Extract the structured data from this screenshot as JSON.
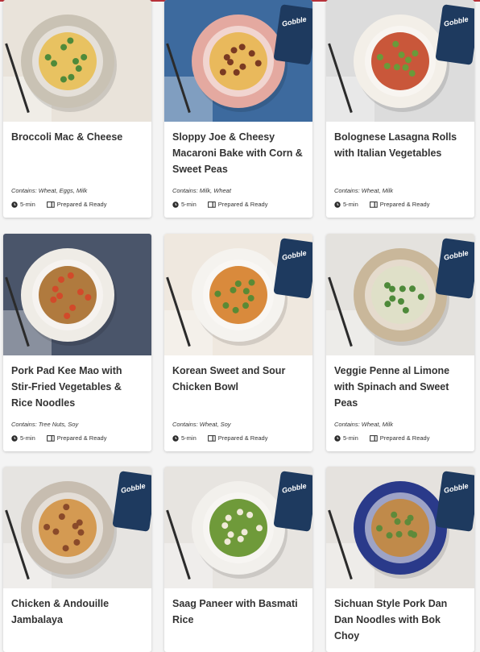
{
  "meals": [
    {
      "title": "Broccoli Mac & Cheese",
      "contains": "Contains: Wheat, Eggs, Milk",
      "time": "5-min",
      "tag": "Prepared & Ready",
      "plate_color": "#c9c2b4",
      "food_color": "#e8c261",
      "accent_color": "#4f8a3a",
      "bg_color": "#e9e3da"
    },
    {
      "title": "Sloppy Joe & Cheesy Macaroni Bake with Corn & Sweet Peas",
      "contains": "Contains: Milk, Wheat",
      "time": "5-min",
      "tag": "Prepared & Ready",
      "plate_color": "#e4a9a0",
      "food_color": "#e9b95c",
      "accent_color": "#7a3a22",
      "bg_color": "#3d6a9e"
    },
    {
      "title": "Bolognese Lasagna Rolls with Italian Vegetables",
      "contains": "Contains: Wheat, Milk",
      "time": "5-min",
      "tag": "Prepared & Ready",
      "plate_color": "#f3efe8",
      "food_color": "#c9573a",
      "accent_color": "#6a9a3a",
      "bg_color": "#dcdcdc"
    },
    {
      "title": "Pork Pad Kee Mao with Stir-Fried Vegetables & Rice Noodles",
      "contains": "Contains: Tree Nuts, Soy",
      "time": "5-min",
      "tag": "Prepared & Ready",
      "plate_color": "#efece6",
      "food_color": "#b07a3e",
      "accent_color": "#d24a2a",
      "bg_color": "#4a556a"
    },
    {
      "title": "Korean Sweet and Sour Chicken Bowl",
      "contains": "Contains: Wheat, Soy",
      "time": "5-min",
      "tag": "Prepared & Ready",
      "plate_color": "#f5f3ef",
      "food_color": "#d98a3c",
      "accent_color": "#5a8a35",
      "bg_color": "#efe8df"
    },
    {
      "title": "Veggie Penne al Limone with Spinach and Sweet Peas",
      "contains": "Contains: Wheat, Milk",
      "time": "5-min",
      "tag": "Prepared & Ready",
      "plate_color": "#c9b79a",
      "food_color": "#dfe0c8",
      "accent_color": "#4e8a3a",
      "bg_color": "#e4e2de"
    },
    {
      "title": "Chicken & Andouille Jambalaya",
      "contains": "",
      "time": "",
      "tag": "",
      "plate_color": "#c7bdb0",
      "food_color": "#d49a52",
      "accent_color": "#8a4a2a",
      "bg_color": "#e6e4e1"
    },
    {
      "title": "Saag Paneer with Basmati Rice",
      "contains": "",
      "time": "",
      "tag": "",
      "plate_color": "#f2f0ec",
      "food_color": "#6f9a3a",
      "accent_color": "#f0ead8",
      "bg_color": "#e7e4e0"
    },
    {
      "title": "Sichuan Style Pork Dan Dan Noodles with Bok Choy",
      "contains": "",
      "time": "",
      "tag": "",
      "plate_color": "#2a3a8a",
      "food_color": "#c08a4a",
      "accent_color": "#5f8a3a",
      "bg_color": "#e5e2de"
    }
  ],
  "brand_label": "Gobble",
  "brand_color": "#1e3a5f",
  "accent_line_color": "#b8323a"
}
